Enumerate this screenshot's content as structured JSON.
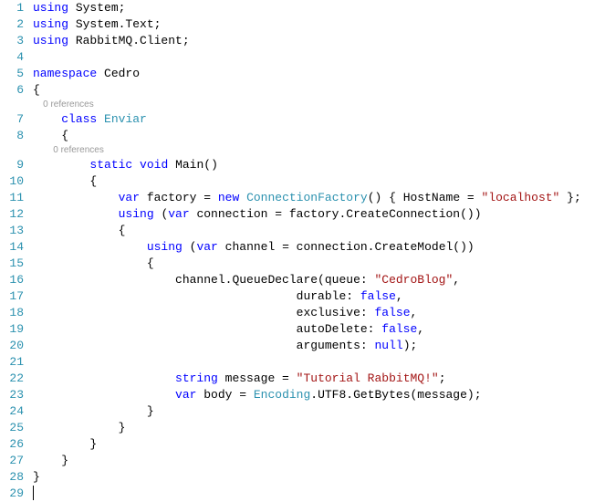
{
  "gutter": {
    "1": "1",
    "2": "2",
    "3": "3",
    "4": "4",
    "5": "5",
    "6": "6",
    "7": "7",
    "8": "8",
    "9": "9",
    "10": "10",
    "11": "11",
    "12": "12",
    "13": "13",
    "14": "14",
    "15": "15",
    "16": "16",
    "17": "17",
    "18": "18",
    "19": "19",
    "20": "20",
    "21": "21",
    "22": "22",
    "23": "23",
    "24": "24",
    "25": "25",
    "26": "26",
    "27": "27",
    "28": "28",
    "29": "29"
  },
  "codelens": {
    "class": "0 references",
    "method": "0 references"
  },
  "kw": {
    "using": "using",
    "namespace": "namespace",
    "class": "class",
    "static": "static",
    "void": "void",
    "var": "var",
    "new": "new",
    "false": "false",
    "null": "null",
    "string": "string"
  },
  "type": {
    "ConnectionFactory": "ConnectionFactory",
    "Encoding": "Encoding"
  },
  "str": {
    "localhost": "\"localhost\"",
    "cedroblog": "\"CedroBlog\"",
    "tutorial": "\"Tutorial RabbitMQ!\""
  },
  "txt": {
    "ns_system": " System;",
    "ns_system_text": " System.Text;",
    "ns_rabbit": " RabbitMQ.Client;",
    "ns_cedro": " Cedro",
    "class_name": " Enviar",
    "main_name": " Main()",
    "factory_decl": " factory = ",
    "factory_tail": "() { HostName = ",
    "factory_end": " };",
    "using_open": " (",
    "conn_decl": " connection = factory.CreateConnection())",
    "channel_decl": " channel = connection.CreateModel())",
    "queue_declare": "channel.QueueDeclare(queue: ",
    "comma": ",",
    "durable": "durable: ",
    "exclusive": "exclusive: ",
    "autoDelete": "autoDelete: ",
    "arguments": "arguments: ",
    "close_paren_semi": ");",
    "message_decl": " message = ",
    "semi": ";",
    "body_decl": " body = ",
    "encoding_tail": ".UTF8.GetBytes(message);",
    "lbrace": "{",
    "rbrace": "}"
  },
  "indent": {
    "i0": "",
    "i1": "    ",
    "i2": "        ",
    "i3": "            ",
    "i4": "                ",
    "i5": "                    ",
    "i6": "                                     "
  }
}
